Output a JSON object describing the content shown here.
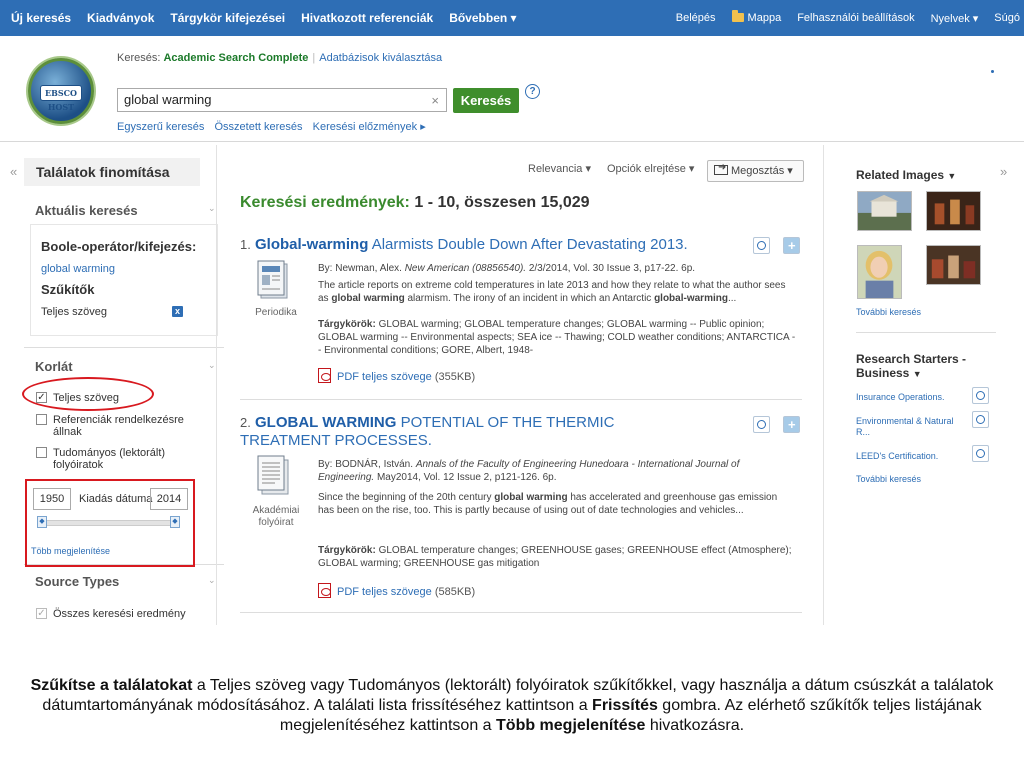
{
  "topnav": {
    "left": [
      "Új keresés",
      "Kiadványok",
      "Tárgykör kifejezései",
      "Hivatkozott referenciák",
      "Bővebben ▾"
    ],
    "login": "Belépés",
    "folder": "Mappa",
    "settings": "Felhasználói beállítások",
    "languages": "Nyelvek ▾",
    "help": "Súgó"
  },
  "logo": {
    "text": "EBSCO HOST"
  },
  "search": {
    "label_prefix": "Keresés:",
    "database": "Academic Search Complete",
    "choose_db": "Adatbázisok kiválasztása",
    "query": "global warming",
    "clear": "×",
    "button": "Keresés",
    "help": "?",
    "links": [
      "Egyszerű keresés",
      "Összetett keresés",
      "Keresési előzmények ▸"
    ]
  },
  "sidebar": {
    "collapse_left": "«",
    "collapse_right": "»",
    "title": "Találatok finomítása",
    "current_search": "Aktuális keresés",
    "boolean_label": "Boole-operátor/kifejezés:",
    "boolean_value": "global warming",
    "limiters_label": "Szűkítők",
    "limiter_fulltext": "Teljes szöveg",
    "remove": "x",
    "limit_section": "Korlát",
    "checkboxes": [
      {
        "label": "Teljes szöveg",
        "checked": true
      },
      {
        "label": "Referenciák rendelkezésre állnak",
        "checked": false
      },
      {
        "label": "Tudományos (lektorált) folyóiratok",
        "checked": false
      }
    ],
    "date_from": "1950",
    "date_label": "Kiadás dátuma",
    "date_to": "2014",
    "more": "Több megjelenítése",
    "source_types": "Source Types",
    "source_all": "Összes keresési eredmény"
  },
  "toolbar": {
    "relevance": "Relevancia ▾",
    "options": "Opciók elrejtése ▾",
    "share": "Megosztás ▾"
  },
  "results": {
    "heading": "Keresési eredmények:",
    "count": "1 - 10, összesen 15,029",
    "items": [
      {
        "num": "1.",
        "title_hl": "Global-warming",
        "title_rest": " Alarmists Double Down After Devastating 2013.",
        "byline": "By: Newman, Alex.",
        "source": "New American (08856540).",
        "details": "2/3/2014, Vol. 30 Issue 3, p17-22. 6p.",
        "abstract_a": "The article reports on extreme cold temperatures in late 2013 and how they relate to what the author sees as ",
        "abstract_b": "global warming",
        "abstract_c": " alarmism. The irony of an incident in which an Antarctic ",
        "abstract_d": "global-warming",
        "abstract_e": "...",
        "subjects_label": "Tárgykörök:",
        "subjects": "GLOBAL warming; GLOBAL temperature changes; GLOBAL warming -- Public opinion; GLOBAL warming -- Environmental aspects; SEA ice -- Thawing; COLD weather conditions; ANTARCTICA -- Environmental conditions; GORE, Albert, 1948-",
        "pubtype": "Periodika",
        "pdf": "PDF teljes szövege",
        "pdf_size": "(355KB)"
      },
      {
        "num": "2.",
        "title_hl": "GLOBAL WARMING",
        "title_rest_1": " POTENTIAL OF THE THERMIC",
        "title_rest_2": "TREATMENT PROCESSES.",
        "byline": "By: BODNÁR, István.",
        "source": "Annals of the Faculty of Engineering Hunedoara - International Journal of Engineering.",
        "details": "May2014, Vol. 12 Issue 2, p121-126. 6p.",
        "abstract_a": "Since the beginning of the 20th century ",
        "abstract_b": "global warming",
        "abstract_c": " has accelerated and greenhouse gas emission has been on the rise, too. This is partly because of using out of date technologies and vehicles...",
        "subjects_label": "Tárgykörök:",
        "subjects": "GLOBAL temperature changes; GREENHOUSE gases; GREENHOUSE effect (Atmosphere); GLOBAL warming; GREENHOUSE gas mitigation",
        "pubtype": "Akadémiai folyóirat",
        "pdf": "PDF teljes szövege",
        "pdf_size": "(585KB)"
      }
    ]
  },
  "right": {
    "related_images": "Related Images",
    "more_search_1": "További keresés",
    "research_starters": "Research Starters - Business",
    "starters": [
      "Insurance Operations.",
      "Environmental & Natural R...",
      "LEED's Certification."
    ],
    "more_search_2": "További keresés"
  },
  "caption": {
    "b1": "Szűkítse a találatokat",
    "t1": " a Teljes szöveg vagy Tudományos (lektorált) folyóiratok szűkítőkkel, vagy használja a dátum csúszkát a találatok dátumtartományának módosításához. A találati lista frissítéséhez kattintson a ",
    "b2": "Frissítés",
    "t2": " gombra. Az elérhető szűkítők teljes listájának megjelenítéséhez kattintson a ",
    "b3": "Több megjelenítése",
    "t3": " hivatkozásra."
  },
  "colors": {
    "nav": "#2e6eb5",
    "accent_green": "#3f8e2c",
    "highlight_red": "#d8191f",
    "link": "#2e6eb5"
  }
}
